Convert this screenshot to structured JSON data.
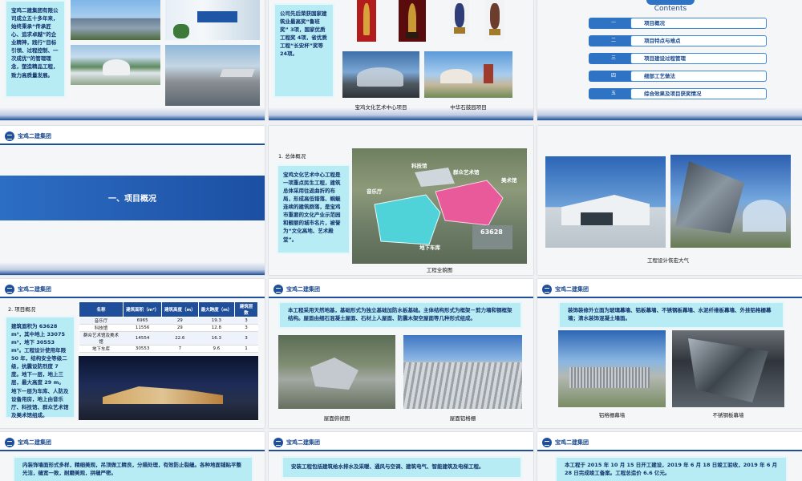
{
  "company": "宝鸡二建集团",
  "slides": {
    "s1": {
      "text": "宝鸡二建集团有限公司成立五十多年来，始终秉承“传承匠心、追求卓越”的企业精神，践行“目标引领、过程控制、一次成优”的管理理念，塑造精品工程，致力高质量发展。"
    },
    "s2": {
      "text": "公司先后荣获国家建筑业最高奖“鲁班奖” 3项，国家优质工程奖 4项，省优质工程“长安杯”奖等 24项。",
      "caption_left": "宝鸡文化艺术中心项目",
      "caption_right": "中华石鼓园项目"
    },
    "s3": {
      "heading": "Contents",
      "items": [
        {
          "num": "一",
          "label": "项目概况"
        },
        {
          "num": "二",
          "label": "项目特点与难点"
        },
        {
          "num": "三",
          "label": "项目建设过程管理"
        },
        {
          "num": "四",
          "label": "细部工艺做法"
        },
        {
          "num": "五",
          "label": "综合效果及项目获奖情况"
        }
      ]
    },
    "s4": {
      "title": "一、项目概况"
    },
    "s5": {
      "subtitle": "1. 总体概况",
      "text": "宝鸡文化艺术中心工程是一项重点民生工程，建筑总体采用往返曲折的布局，形成高低错落、蜿蜒连续的建筑群落，是宝鸡市重要的文化产业示范园和靓丽的城市名片，被誉为“文化高地、艺术殿堂”。",
      "labels": [
        "科技馆",
        "群众艺术馆",
        "美术馆",
        "音乐厅",
        "地下车库"
      ],
      "area_tag": "63628",
      "caption": "工程全貌图"
    },
    "s6": {
      "caption": "工程设计恢宏大气"
    },
    "s7": {
      "subtitle": "2. 项目概况",
      "text": "建筑面积为 63628 m²，其中地上 33075 m²，地下 30553 m²。工程设计使用年限 50 年，结构安全等级二级，抗震设防烈度 7 度。地下一层，地上三层，最大高度 29 m。地下一层为车库、人防及设备用房，地上由音乐厅、科技馆、群众艺术馆及美术馆组成。",
      "table": {
        "headers": [
          "名称",
          "建筑面积（m²）",
          "建筑高度（m）",
          "最大跨度（m）",
          "建筑层数"
        ],
        "rows": [
          [
            "音乐厅",
            "6965",
            "29",
            "19.3",
            "3"
          ],
          [
            "科技馆",
            "11556",
            "29",
            "12.8",
            "3"
          ],
          [
            "群众艺术馆及美术馆",
            "14554",
            "22.6",
            "16.3",
            "3"
          ],
          [
            "地下车库",
            "30553",
            "7",
            "9.6",
            "1"
          ]
        ]
      }
    },
    "s8": {
      "text": "本工程采用天然地基，基础形式为独立基础加防水板基础。主体结构形式为框架－剪力墙和钢框架结构。屋面由细石混凝土屋面、石材上人屋面、防震木架空屋面等几种形式组成。",
      "caption_left": "屋面俯视图",
      "caption_right": "屋面铝格栅"
    },
    "s9": {
      "text": "装饰装修外立面为玻璃幕墙、铝板幕墙、不锈钢板幕墙、水泥纤维板幕墙、外挂铝格栅幕墙；清水装饰混凝土墙面。",
      "caption_left": "铝格栅幕墙",
      "caption_right": "不锈钢板幕墙"
    },
    "s10": {
      "text": "内装饰墙面形式多样，精细美观，吊顶做工精良，分隔处理，有效防止裂缝。各种地面铺贴平整光洁，缝宽一致，耐磨美观，拼缝严密。"
    },
    "s11": {
      "text": "安装工程包括建筑给水排水及采暖、通风与空调、建筑电气、智能建筑及电梯工程。"
    },
    "s12": {
      "text": "本工程于 2015 年 10 月 15 日开工建设，2019 年 6 月 18 日竣工验收，2019 年 6 月 28 日完成竣工备案。工程总造价 6.6 亿元。"
    }
  }
}
